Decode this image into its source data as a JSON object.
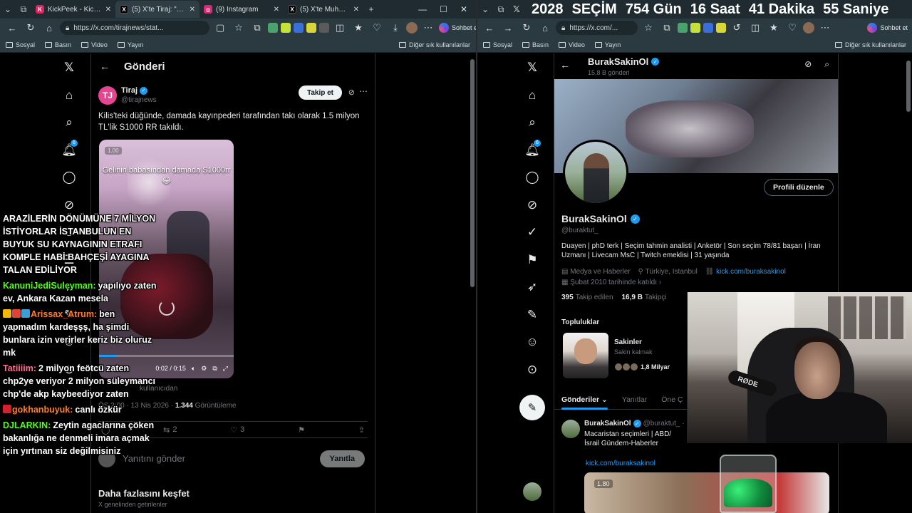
{
  "left_browser": {
    "tabs": [
      {
        "title": "KickPeek - Kick.com iç",
        "favicon": "kick-icon",
        "color": "#e0245e",
        "active": false
      },
      {
        "title": "(5) X'te Tiraj: \"Kilis",
        "favicon": "x-icon",
        "color": "#000000",
        "active": true
      },
      {
        "title": "(9) Instagram",
        "favicon": "instagram-icon",
        "color": "#d62976",
        "active": false
      },
      {
        "title": "(5) X'te Muhbir: \"A",
        "favicon": "x-icon",
        "color": "#000000",
        "active": false
      }
    ],
    "url": "https://x.com/tirajnews/stat...",
    "chat_button": "Sohbet et",
    "bookmarks": [
      "Sosyal",
      "Basın",
      "Video",
      "Yayın"
    ],
    "bookmarks_right": "Diğer sık kullanılanlar"
  },
  "left_page": {
    "header_title": "Gönderi",
    "notification_count": "6",
    "author": {
      "initials": "TJ",
      "name": "Tiraj",
      "handle": "@tirajnews"
    },
    "follow_button": "Takip et",
    "tweet_text": "Kilis'teki düğünde, damada kayınpederi tarafından takı olarak 1.5 milyon TL'lik S1000 RR takıldı.",
    "video": {
      "speed": "1.00",
      "overlay_text": "Gelinin babasından damada S1000rr😂",
      "time": "0:02 / 0:15",
      "progress": 0.13
    },
    "source": "kullanıcıdan",
    "meta": {
      "time": "ÖS 2:00 · 13 Nis 2026 ·",
      "views_count": "1.344",
      "views_label": "Görüntüleme"
    },
    "actions": {
      "replies": "",
      "reposts": "2",
      "likes": "3"
    },
    "reply_placeholder": "Yanıtını gönder",
    "reply_button": "Yanıtla",
    "discover_title": "Daha fazlasını keşfet",
    "discover_sub": "X genelinden getirilenler"
  },
  "chat": [
    {
      "user": "",
      "color": "#ffffff",
      "text": "ARAZİLERİN DÖNÜMÜNE 7 MİLYON İSTİYORLAR İSTANBULUN EN BUYUK SU KAYNAGININ ETRAFI KOMPLE HABİ BAHÇEŞİ AYAGINA TALAN EDİLİYOR"
    },
    {
      "user": "KanuniJediSuleyman:",
      "color": "#53fc18",
      "text": "yapılıyo zaten ev, Ankara Kazan mesela"
    },
    {
      "user": "Arissax_Atrum:",
      "color": "#ff7f27",
      "text": "ben yapmadım kardeşşş, ha şimdi bunlara izin verirler keriz biz oluruz mk"
    },
    {
      "user": "Tatiiiim:",
      "color": "#ff6e91",
      "text": "2 milyon feötcü zaten chp2ye veriyor 2 milyon süleymancı chp'de akp kaybeediyor zaten"
    },
    {
      "user": "gokhanbuyuk:",
      "color": "#ff7f27",
      "text": "canlı özkür"
    },
    {
      "user": "DJLARKIN:",
      "color": "#53fc18",
      "text": "Zeytin agaclarına çöken bakanlığa ne denmeli imara açmak için yırtınan siz değilmisiniz"
    }
  ],
  "right_browser": {
    "countdown": {
      "year": "2028",
      "label": "SEÇİM",
      "days": "754 Gün",
      "hours": "16 Saat",
      "minutes": "41 Dakika",
      "seconds": "55 Saniye"
    },
    "url": "https://x.com/...",
    "chat_button": "Sohbet et",
    "bookmarks": [
      "Sosyal",
      "Basın",
      "Video",
      "Yayın"
    ],
    "bookmarks_right": "Diğer sık kullanılanlar"
  },
  "right_page": {
    "notification_count": "6",
    "header_name": "BurakSakinOl",
    "header_count": "15,8 B gönderi",
    "edit_profile": "Profili düzenle",
    "name": "BurakSakinOl",
    "handle": "@buraktut_",
    "bio": "Duayen | phD terk | Seçim tahmin analisti | Anketör | Son seçim 78/81 başarı | İran Uzmanı | Livecam MsC | Twitch emeklisi | 31 yaşında",
    "category": "Medya ve Haberler",
    "location": "Türkiye, Istanbul",
    "link": "kick.com/buraksakinol",
    "joined": "Şubat 2010 tarihinde katıldı",
    "following_count": "395",
    "following_label": "Takip edilen",
    "followers_count": "16,9 B",
    "followers_label": "Takipçi",
    "communities_heading": "Topluluklar",
    "community": {
      "name": "Sakinler",
      "sub": "Sakin kalmak",
      "members": "1,8 Milyar"
    },
    "tabs": [
      "Gönderiler",
      "Yanıtlar",
      "Öne Ç"
    ],
    "post": {
      "name": "BurakSakinOl",
      "handle": "@buraktut_ ·",
      "text": "Macaristan seçimleri | ABD/İsrail Gündem-Haberler",
      "link": "kick.com/buraksakinol",
      "speed": "1.80"
    }
  },
  "webcam": {
    "mic_label": "RØDE"
  }
}
